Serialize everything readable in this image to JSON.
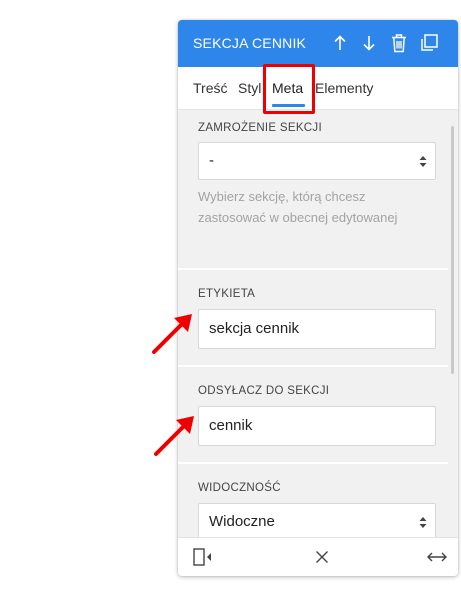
{
  "panel": {
    "title": "SEKCJA CENNIK",
    "accent_color": "#2f86ea",
    "header_icons": [
      "arrow-up-icon",
      "arrow-down-icon",
      "trash-icon",
      "duplicate-icon"
    ]
  },
  "tabs": [
    {
      "label": "Treść",
      "active": false
    },
    {
      "label": "Styl",
      "active": false
    },
    {
      "label": "Meta",
      "active": true
    },
    {
      "label": "Elementy",
      "active": false
    }
  ],
  "sections": {
    "freeze": {
      "label": "ZAMROŻENIE SEKCJI",
      "value": "-",
      "hint": "Wybierz sekcję, którą chcesz zastosować w obecnej edytowanej"
    },
    "label_field": {
      "label": "ETYKIETA",
      "value": "sekcja cennik"
    },
    "anchor": {
      "label": "ODSYŁACZ DO SEKCJI",
      "value": "cennik"
    },
    "visibility": {
      "label": "WIDOCZNOŚĆ",
      "value": "Widoczne"
    }
  },
  "footer": {
    "icons": [
      "collapse-panel-icon",
      "close-icon",
      "expand-horizontal-icon"
    ]
  },
  "annotations": {
    "highlight_color": "#ee0000"
  }
}
